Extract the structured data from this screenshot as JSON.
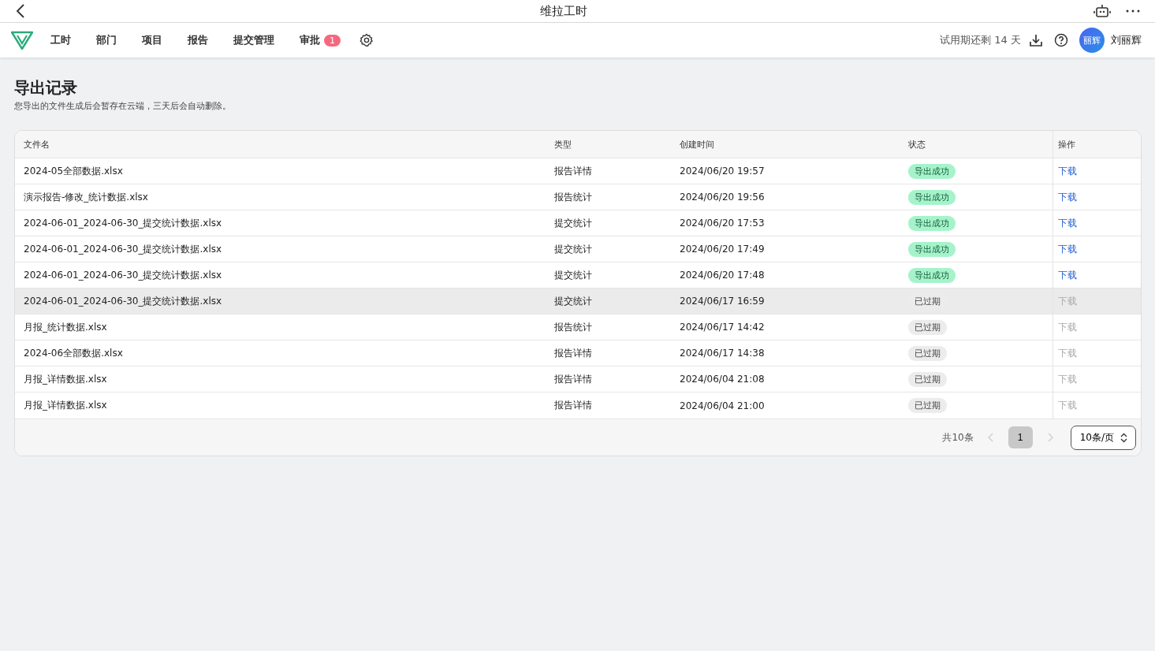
{
  "window": {
    "title": "维拉工时"
  },
  "nav": {
    "items": [
      {
        "label": "工时",
        "selected": false
      },
      {
        "label": "部门",
        "selected": false
      },
      {
        "label": "项目",
        "selected": false
      },
      {
        "label": "报告",
        "selected": false
      },
      {
        "label": "提交管理",
        "selected": false
      },
      {
        "label": "审批",
        "selected": false,
        "badge": "1"
      }
    ],
    "trial": "试用期还剩 14 天",
    "avatar": "丽辉",
    "user": "刘丽辉"
  },
  "page": {
    "title": "导出记录",
    "subtitle": "您导出的文件生成后会暂存在云端，三天后会自动删除。"
  },
  "table": {
    "columns": [
      "文件名",
      "类型",
      "创建时间",
      "状态",
      "操作"
    ],
    "rows": [
      {
        "file": "2024-05全部数据.xlsx",
        "type": "报告详情",
        "time": "2024/06/20 19:57",
        "status": "导出成功",
        "kind": "success",
        "action": "下载",
        "disabled": false,
        "highlighted": false
      },
      {
        "file": "演示报告-修改_统计数据.xlsx",
        "type": "报告统计",
        "time": "2024/06/20 19:56",
        "status": "导出成功",
        "kind": "success",
        "action": "下载",
        "disabled": false,
        "highlighted": false
      },
      {
        "file": "2024-06-01_2024-06-30_提交统计数据.xlsx",
        "type": "提交统计",
        "time": "2024/06/20 17:53",
        "status": "导出成功",
        "kind": "success",
        "action": "下载",
        "disabled": false,
        "highlighted": false
      },
      {
        "file": "2024-06-01_2024-06-30_提交统计数据.xlsx",
        "type": "提交统计",
        "time": "2024/06/20 17:49",
        "status": "导出成功",
        "kind": "success",
        "action": "下载",
        "disabled": false,
        "highlighted": false
      },
      {
        "file": "2024-06-01_2024-06-30_提交统计数据.xlsx",
        "type": "提交统计",
        "time": "2024/06/20 17:48",
        "status": "导出成功",
        "kind": "success",
        "action": "下载",
        "disabled": false,
        "highlighted": false
      },
      {
        "file": "2024-06-01_2024-06-30_提交统计数据.xlsx",
        "type": "提交统计",
        "time": "2024/06/17 16:59",
        "status": "已过期",
        "kind": "expired",
        "action": "下载",
        "disabled": true,
        "highlighted": true
      },
      {
        "file": "月报_统计数据.xlsx",
        "type": "报告统计",
        "time": "2024/06/17 14:42",
        "status": "已过期",
        "kind": "expired",
        "action": "下载",
        "disabled": true,
        "highlighted": false
      },
      {
        "file": "2024-06全部数据.xlsx",
        "type": "报告详情",
        "time": "2024/06/17 14:38",
        "status": "已过期",
        "kind": "expired",
        "action": "下载",
        "disabled": true,
        "highlighted": false
      },
      {
        "file": "月报_详情数据.xlsx",
        "type": "报告详情",
        "time": "2024/06/04 21:08",
        "status": "已过期",
        "kind": "expired",
        "action": "下载",
        "disabled": true,
        "highlighted": false
      },
      {
        "file": "月报_详情数据.xlsx",
        "type": "报告详情",
        "time": "2024/06/04 21:00",
        "status": "已过期",
        "kind": "expired",
        "action": "下载",
        "disabled": true,
        "highlighted": false
      }
    ]
  },
  "pagination": {
    "total": "共10条",
    "pages": [
      {
        "label": "1",
        "selected": true
      }
    ],
    "page_size": "10条/页"
  }
}
